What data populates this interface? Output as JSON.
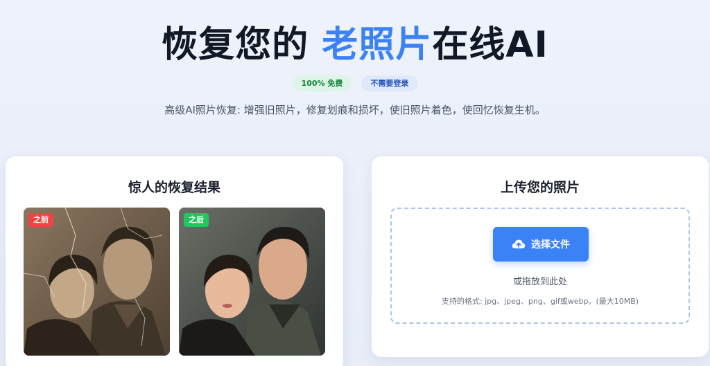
{
  "hero": {
    "title_part1": "恢复您的 ",
    "title_accent": "老照片",
    "title_part2": "在线AI",
    "badge_free": "100% 免费",
    "badge_nologin": "不需要登录",
    "subtitle": "高级AI照片恢复: 增强旧照片，修复划痕和损坏，使旧照片着色，使回忆恢复生机。"
  },
  "results": {
    "title": "惊人的恢复结果",
    "before_label": "之前",
    "after_label": "之后"
  },
  "upload": {
    "title": "上传您的照片",
    "button_label": "选择文件",
    "drop_hint": "或拖放到此处",
    "format_hint": "支持的格式: jpg、jpeg、png、gif或webp。(最大10MB)"
  },
  "colors": {
    "accent": "#3b82f6",
    "before_tag": "#ef4444",
    "after_tag": "#22c55e"
  },
  "icons": {
    "upload_button_icon": "cloud-upload-icon"
  }
}
